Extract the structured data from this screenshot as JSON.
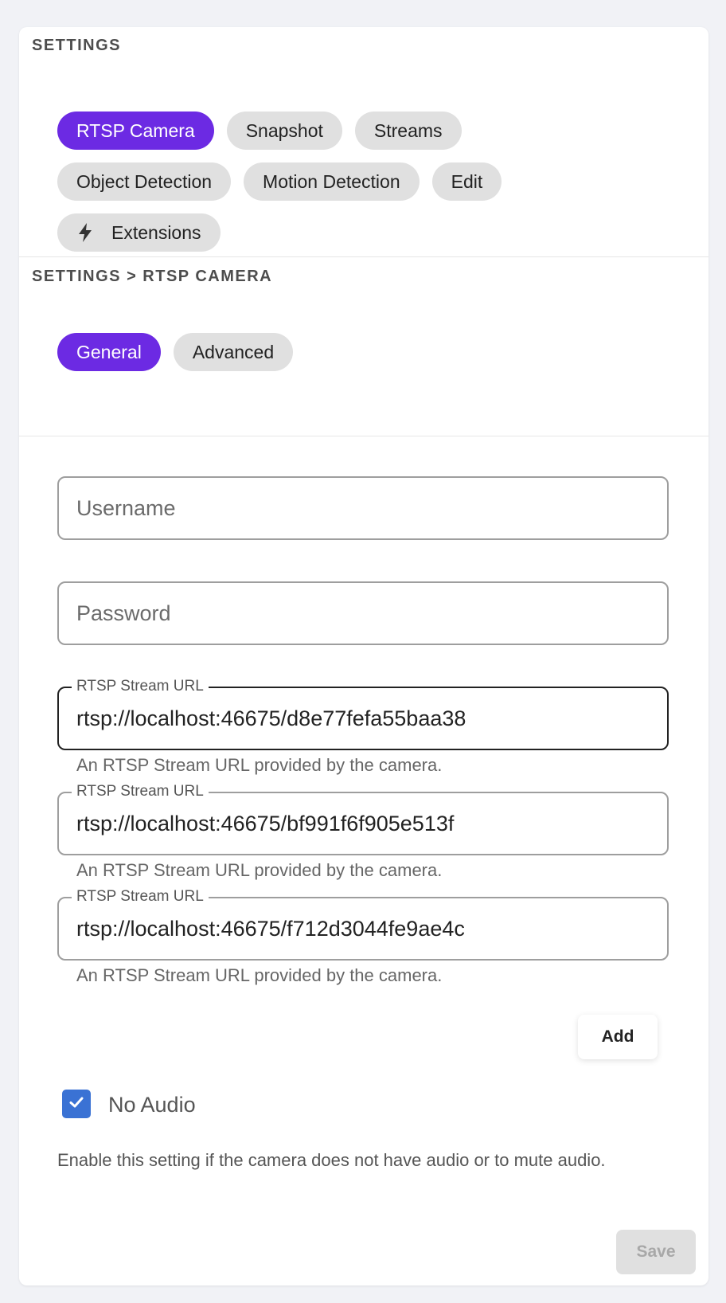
{
  "settings_header": "SETTINGS",
  "main_tabs": [
    {
      "label": "RTSP Camera",
      "active": true
    },
    {
      "label": "Snapshot",
      "active": false
    },
    {
      "label": "Streams",
      "active": false
    },
    {
      "label": "Object Detection",
      "active": false
    },
    {
      "label": "Motion Detection",
      "active": false
    },
    {
      "label": "Edit",
      "active": false
    },
    {
      "label": "Extensions",
      "active": false,
      "icon": "bolt-icon"
    }
  ],
  "sub_header": "SETTINGS > RTSP CAMERA",
  "sub_tabs": [
    {
      "label": "General",
      "active": true
    },
    {
      "label": "Advanced",
      "active": false
    }
  ],
  "form": {
    "username": {
      "placeholder": "Username",
      "value": ""
    },
    "password": {
      "placeholder": "Password",
      "value": ""
    },
    "streams": [
      {
        "label": "RTSP Stream URL",
        "value": "rtsp://localhost:46675/d8e77fefa55baa38",
        "helper": "An RTSP Stream URL provided by the camera."
      },
      {
        "label": "RTSP Stream URL",
        "value": "rtsp://localhost:46675/bf991f6f905e513f",
        "helper": "An RTSP Stream URL provided by the camera."
      },
      {
        "label": "RTSP Stream URL",
        "value": "rtsp://localhost:46675/f712d3044fe9ae4c",
        "helper": "An RTSP Stream URL provided by the camera."
      }
    ],
    "add_label": "Add",
    "no_audio": {
      "label": "No Audio",
      "checked": true,
      "helper": "Enable this setting if the camera does not have audio or to mute audio."
    },
    "save_label": "Save"
  },
  "colors": {
    "accent": "#6c2ae3",
    "checkbox": "#3a72d4",
    "chip_bg": "#e0e0e0"
  }
}
